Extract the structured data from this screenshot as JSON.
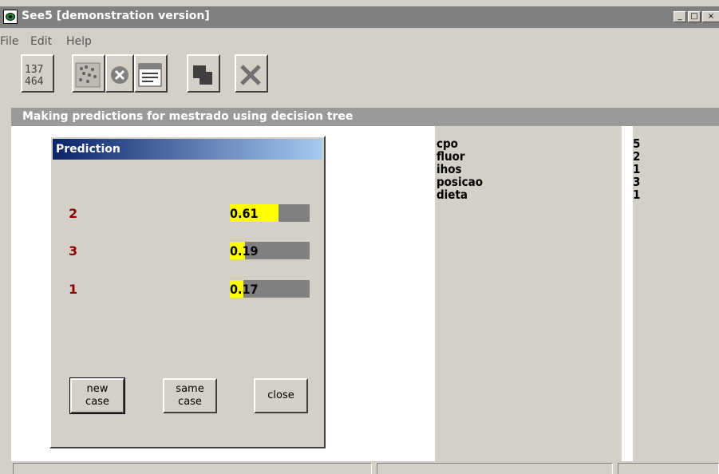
{
  "window": {
    "title": "See5 [demonstration version]"
  },
  "menu": {
    "items": [
      "File",
      "Edit",
      "Help"
    ]
  },
  "subtitle": "Making predictions for mestrado using decision tree",
  "attributes": [
    {
      "name": "cpo",
      "value": "5"
    },
    {
      "name": "fluor",
      "value": "2"
    },
    {
      "name": "ihos",
      "value": "1"
    },
    {
      "name": "posicao",
      "value": "3"
    },
    {
      "name": "dieta",
      "value": "1"
    }
  ],
  "prediction": {
    "title": "Prediction",
    "rows": [
      {
        "class": "2",
        "confidence": "0.61",
        "fraction": 0.61
      },
      {
        "class": "3",
        "confidence": "0.19",
        "fraction": 0.19
      },
      {
        "class": "1",
        "confidence": "0.17",
        "fraction": 0.17
      }
    ],
    "buttons": {
      "new_case": "new\ncase",
      "same_case": "same\ncase",
      "close": "close"
    }
  },
  "colors": {
    "prediction_fill": "#ffff00",
    "class_label": "#8b0000"
  }
}
